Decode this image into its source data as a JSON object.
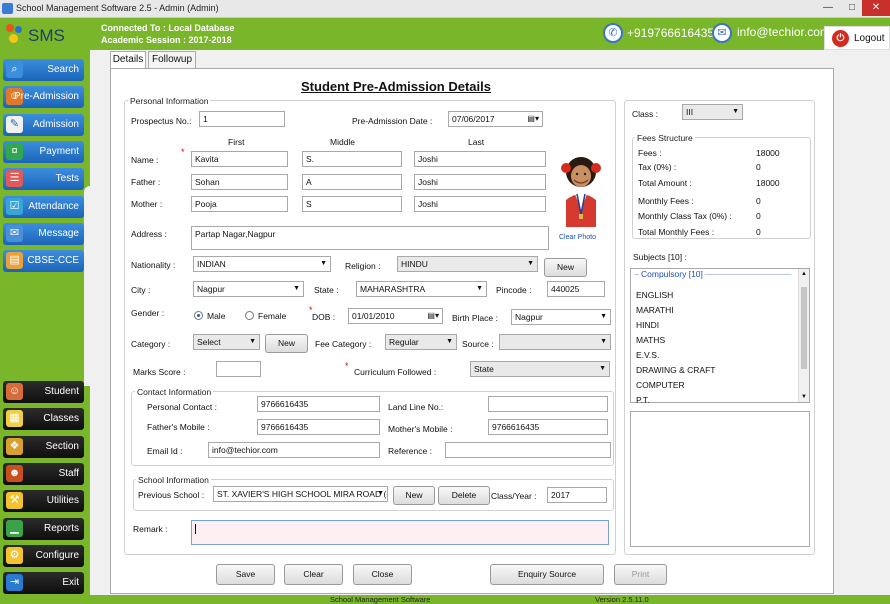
{
  "window": {
    "title": "School Management Software 2.5  - Admin (Admin)"
  },
  "header": {
    "logo_text": "SMS",
    "connected": "Connected To : Local Database",
    "session": "Academic Session : 2017-2018",
    "phone": "+919766616435",
    "email": "info@techior.com",
    "logout": "Logout"
  },
  "sidebar": {
    "top_items": [
      {
        "label": "Search",
        "icon": "search-icon"
      },
      {
        "label": "Pre-Admission",
        "icon": "person-icon"
      },
      {
        "label": "Admission",
        "icon": "pen-icon"
      },
      {
        "label": "Payment",
        "icon": "money-icon"
      },
      {
        "label": "Tests",
        "icon": "test-paper-icon"
      },
      {
        "label": "Attendance",
        "icon": "attendance-icon"
      },
      {
        "label": "Message",
        "icon": "envelope-icon"
      },
      {
        "label": "CBSE-CCE",
        "icon": "book-icon"
      }
    ],
    "bottom_items": [
      {
        "label": "Student",
        "icon": "student-icon"
      },
      {
        "label": "Classes",
        "icon": "classes-icon"
      },
      {
        "label": "Section",
        "icon": "section-icon"
      },
      {
        "label": "Staff",
        "icon": "staff-icon"
      },
      {
        "label": "Utilities",
        "icon": "utilities-icon"
      },
      {
        "label": "Reports",
        "icon": "chart-icon"
      },
      {
        "label": "Configure",
        "icon": "gear-icon"
      },
      {
        "label": "Exit",
        "icon": "exit-icon"
      }
    ]
  },
  "tabs": [
    "Details",
    "Followup"
  ],
  "form": {
    "title": "Student Pre-Admission Details",
    "personal_legend": "Personal Information",
    "prospectus_label": "Prospectus No.:",
    "prospectus_value": "1",
    "preadm_date_label": "Pre-Admission Date :",
    "preadm_date_value": "07/06/2017",
    "col_first": "First",
    "col_middle": "Middle",
    "col_last": "Last",
    "name_label": "Name :",
    "name": {
      "first": "Kavita",
      "middle": "S.",
      "last": "Joshi"
    },
    "father_label": "Father :",
    "father": {
      "first": "Sohan",
      "middle": "A",
      "last": "Joshi"
    },
    "mother_label": "Mother :",
    "mother": {
      "first": "Pooja",
      "middle": "S",
      "last": "Joshi"
    },
    "clear_photo": "Clear Photo",
    "address_label": "Address :",
    "address_value": "Partap Nagar,Nagpur",
    "nationality_label": "Nationality :",
    "nationality_value": "INDIAN",
    "religion_label": "Religion :",
    "religion_value": "HINDU",
    "new_label": "New",
    "city_label": "City :",
    "city_value": "Nagpur",
    "state_label": "State :",
    "state_value": "MAHARASHTRA",
    "pincode_label": "Pincode :",
    "pincode_value": "440025",
    "gender_label": "Gender :",
    "gender_male": "Male",
    "gender_female": "Female",
    "dob_label": "DOB :",
    "dob_value": "01/01/2010",
    "birthplace_label": "Birth Place :",
    "birthplace_value": "Nagpur",
    "category_label": "Category :",
    "category_value": "Select",
    "fee_category_label": "Fee Category :",
    "fee_category_value": "Regular",
    "source_label": "Source :",
    "source_value": "",
    "marks_label": "Marks Score :",
    "marks_value": "",
    "curriculum_label": "Curriculum Followed :",
    "curriculum_value": "State",
    "contact_legend": "Contact Information",
    "personal_contact_label": "Personal Contact :",
    "personal_contact_value": "9766616435",
    "landline_label": "Land Line No.:",
    "landline_value": "",
    "father_mobile_label": "Father's Mobile :",
    "father_mobile_value": "9766616435",
    "mother_mobile_label": "Mother's Mobile :",
    "mother_mobile_value": "9766616435",
    "email_label": "Email Id :",
    "email_value": "info@techior.com",
    "reference_label": "Reference :",
    "reference_value": "",
    "school_legend": "School Information",
    "prev_school_label": "Previous School :",
    "prev_school_value": "ST. XAVIER'S HIGH SCHOOL MIRA ROAD (E)",
    "delete_label": "Delete",
    "class_year_label": "Class/Year :",
    "class_year_value": "2017",
    "remark_label": "Remark :",
    "remark_value": ""
  },
  "right": {
    "class_label": "Class :",
    "class_value": "III",
    "fees_legend": "Fees Structure",
    "fees": [
      {
        "label": "Fees :",
        "value": "18000"
      },
      {
        "label": "Tax (0%) :",
        "value": "0"
      },
      {
        "label": "Total Amount :",
        "value": "18000"
      },
      {
        "label": "Monthly Fees :",
        "value": "0"
      },
      {
        "label": "Monthly Class Tax (0%) :",
        "value": "0"
      },
      {
        "label": "Total Monthly Fees :",
        "value": "0"
      }
    ],
    "subjects_label": "Subjects [10] :",
    "subjects_group": "Compulsory [10]",
    "subjects": [
      "ENGLISH",
      "MARATHI",
      "HINDI",
      "MATHS",
      "E.V.S.",
      "DRAWING & CRAFT",
      "COMPUTER",
      "P.T."
    ]
  },
  "actions": {
    "save": "Save",
    "clear": "Clear",
    "close": "Close",
    "enquiry": "Enquiry Source",
    "print": "Print"
  },
  "status": {
    "left": "School Management Software",
    "right": "Version 2.5.11.0"
  }
}
